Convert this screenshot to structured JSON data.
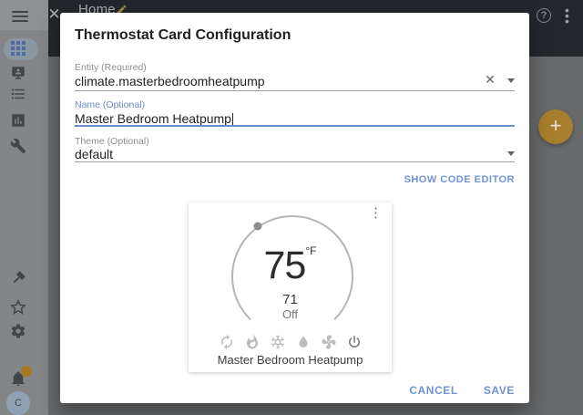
{
  "header": {
    "page_title": "Home"
  },
  "sidebar": {
    "avatar_initial": "C",
    "items": [
      "overview",
      "hassio",
      "logbook",
      "history",
      "tools",
      "developer-tools",
      "community",
      "configuration",
      "notifications"
    ]
  },
  "dialog": {
    "title": "Thermostat Card Configuration",
    "entity": {
      "label": "Entity (Required)",
      "value": "climate.masterbedroomheatpump"
    },
    "name": {
      "label": "Name (Optional)",
      "value": "Master Bedroom Heatpump"
    },
    "theme": {
      "label": "Theme (Optional)",
      "value": "default"
    },
    "code_editor_label": "SHOW CODE EDITOR",
    "preview": {
      "target_temp": "75",
      "unit": "°F",
      "current_temp": "71",
      "hvac_state": "Off",
      "card_name": "Master Bedroom Heatpump",
      "modes": [
        "auto",
        "heat",
        "cool",
        "dry",
        "fan",
        "off"
      ],
      "active_mode": "off"
    },
    "cancel_label": "CANCEL",
    "save_label": "SAVE"
  },
  "fab": {
    "label": "+"
  },
  "colors": {
    "accent_orange_dimmed": "#a87e2d",
    "primary_blue": "#7193d3",
    "header_dark": "#23272c"
  }
}
